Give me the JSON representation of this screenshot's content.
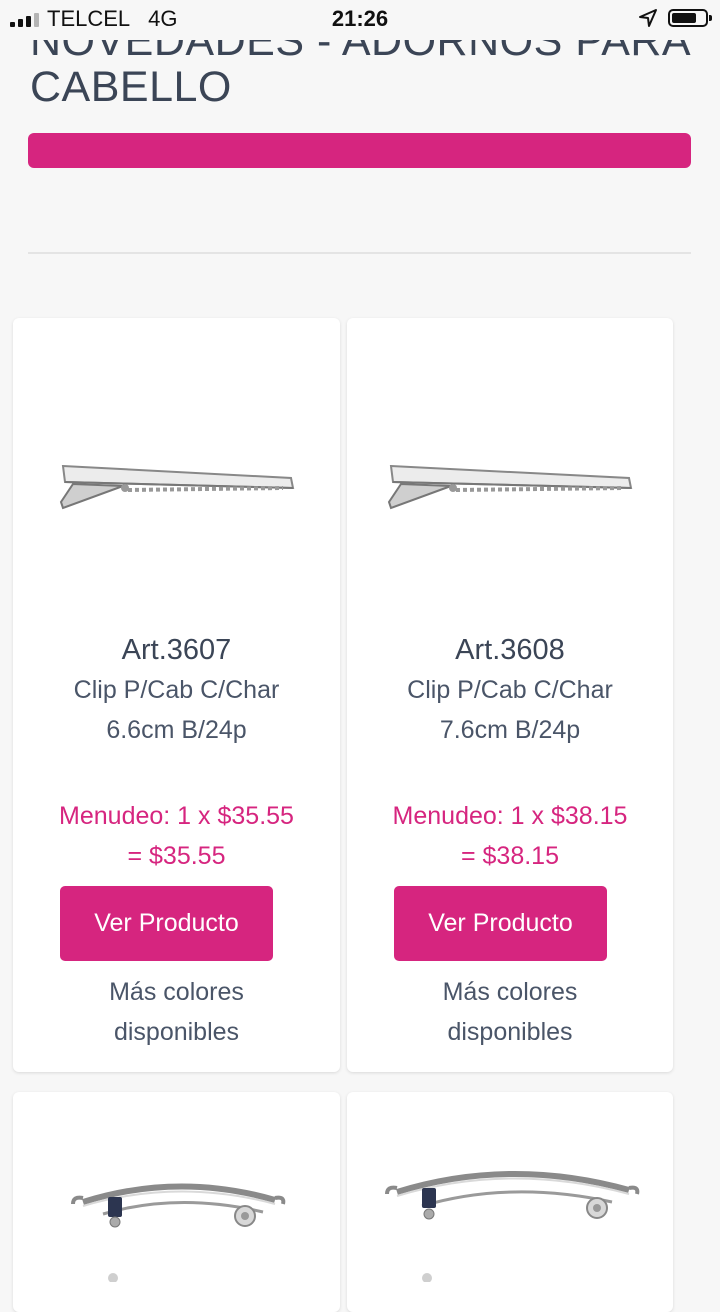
{
  "status_bar": {
    "carrier": "TELCEL",
    "network": "4G",
    "time": "21:26"
  },
  "page": {
    "title": "NOVEDADES - ADORNOS PARA CABELLO"
  },
  "products": [
    {
      "art": "Art.3607",
      "desc_line1": "Clip P/Cab C/Char",
      "desc_line2": "6.6cm B/24p",
      "price_line1": "Menudeo: 1 x $35.55",
      "price_line2": "= $35.55",
      "button": "Ver Producto",
      "more_line1": "Más colores",
      "more_line2": "disponibles",
      "image_icon": "alligator-clip-image"
    },
    {
      "art": "Art.3608",
      "desc_line1": "Clip P/Cab C/Char",
      "desc_line2": "7.6cm B/24p",
      "price_line1": "Menudeo: 1 x $38.15",
      "price_line2": "= $38.15",
      "button": "Ver Producto",
      "more_line1": "Más colores",
      "more_line2": "disponibles",
      "image_icon": "alligator-clip-image"
    },
    {
      "image_icon": "barrette-clip-image"
    },
    {
      "image_icon": "barrette-clip-image"
    }
  ],
  "colors": {
    "accent": "#d6257f",
    "text": "#3b4556"
  }
}
